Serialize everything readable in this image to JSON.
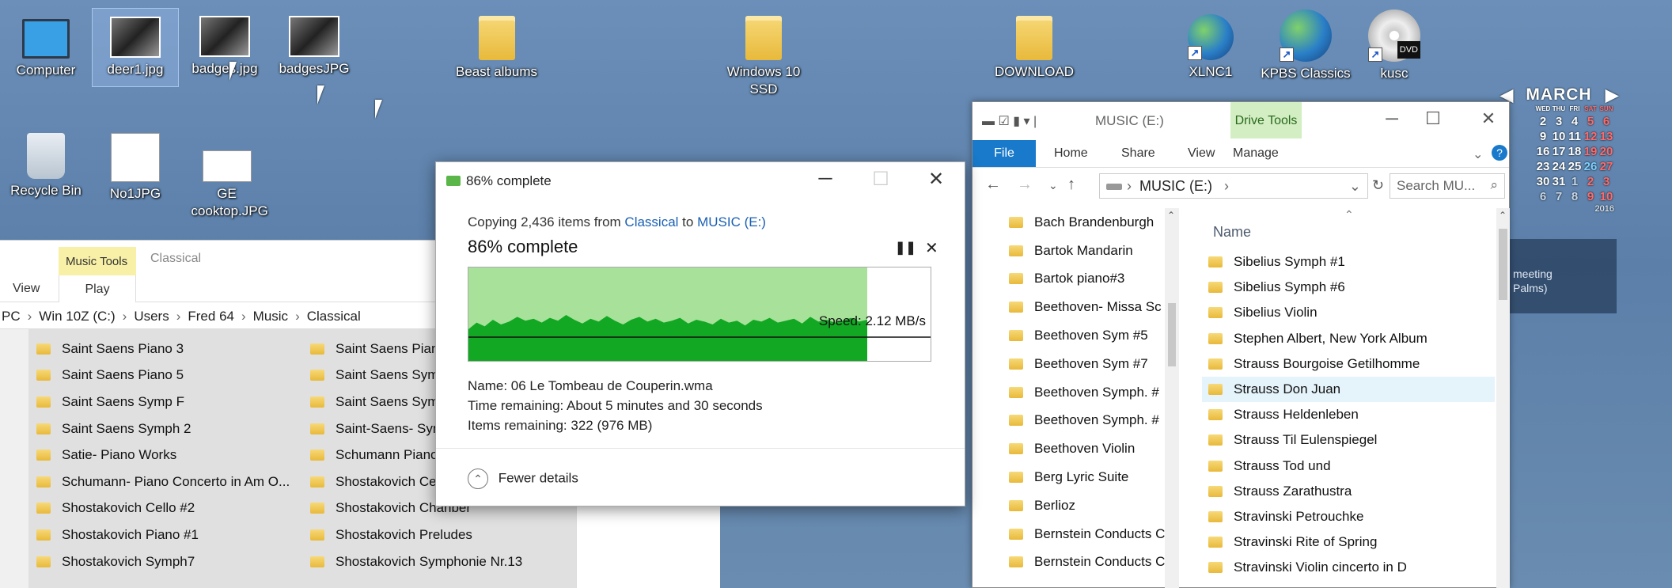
{
  "desktop": {
    "icons": [
      {
        "label": "Computer"
      },
      {
        "label": "deer1.jpg"
      },
      {
        "label": "badges.jpg"
      },
      {
        "label": "badgesJPG"
      },
      {
        "label": "Beast albums"
      },
      {
        "label": "Windows 10 SSD"
      },
      {
        "label": "DOWNLOAD"
      },
      {
        "label": "XLNC1"
      },
      {
        "label": "KPBS Classics"
      },
      {
        "label": "kusc"
      },
      {
        "label": "Recycle Bin"
      },
      {
        "label": "No1JPG"
      },
      {
        "label": "GE cooktop.JPG"
      }
    ],
    "dvd_label": "DVD"
  },
  "calendar": {
    "month": "MARCH",
    "weekdays": [
      "WED",
      "THU",
      "FRI",
      "SAT",
      "SUN"
    ],
    "rows": [
      [
        "2",
        "3",
        "4",
        "5",
        "6"
      ],
      [
        "9",
        "10",
        "11",
        "12",
        "13"
      ],
      [
        "16",
        "17",
        "18",
        "19",
        "20"
      ],
      [
        "23",
        "24",
        "25",
        "26",
        "27"
      ],
      [
        "30",
        "31",
        "1",
        "2",
        "3"
      ],
      [
        "6",
        "7",
        "8",
        "9",
        "10"
      ]
    ],
    "year": "2016"
  },
  "gadget": {
    "line1": "meeting",
    "line2": "Palms)"
  },
  "left_explorer": {
    "ribbon": {
      "context_tab": "Music Tools",
      "context_name": "Classical",
      "tab_view": "View",
      "tab_play": "Play"
    },
    "breadcrumb": [
      "PC",
      "Win 10Z (C:)",
      "Users",
      "Fred 64",
      "Music",
      "Classical"
    ],
    "col1": [
      "Saint Saens Piano 3",
      "Saint Saens Piano 5",
      "Saint Saens Symp F",
      "Saint Saens Symph 2",
      "Satie- Piano Works",
      "Schumann- Piano Concerto in Am O...",
      "Shostakovich Cello #2",
      "Shostakovich Piano #1",
      "Shostakovich Symph7"
    ],
    "col2": [
      "Saint Saens Pianc",
      "Saint Saens Symp",
      "Saint Saens Symp",
      "Saint-Saens- Sym",
      "Schumann Piano",
      "Shostakovich Cel",
      "Shostakovich Chanber",
      "Shostakovich Preludes",
      "Shostakovich Symphonie Nr.13"
    ]
  },
  "right_explorer": {
    "title": "MUSIC (E:)",
    "drive_tools": "Drive Tools",
    "tabs": {
      "file": "File",
      "home": "Home",
      "share": "Share",
      "view": "View",
      "manage": "Manage"
    },
    "address": "MUSIC (E:)",
    "search_placeholder": "Search MU...",
    "column_name": "Name",
    "nav_items": [
      "Bach Brandenburgh",
      "Bartok Mandarin",
      "Bartok piano#3",
      "Beethoven- Missa Sc",
      "Beethoven Sym #5",
      "Beethoven Sym #7",
      "Beethoven Symph. #",
      "Beethoven Symph. #",
      "Beethoven Violin",
      "Berg Lyric Suite",
      "Berlioz",
      "Bernstein Conducts C",
      "Bernstein Conducts C"
    ],
    "files": [
      "Sibelius Symph #1",
      "Sibelius Symph #6",
      "Sibelius Violin",
      "Stephen Albert, New York Album",
      "Strauss Bourgoise Getilhomme",
      "Strauss Don Juan",
      "Strauss Heldenleben",
      "Strauss Til Eulenspiegel",
      "Strauss Tod und",
      "Strauss Zarathustra",
      "Stravinski Petrouchke",
      "Stravinski Rite of Spring",
      "Stravinski Violin cincerto in D"
    ]
  },
  "copy_dialog": {
    "title": "86% complete",
    "copy_prefix": "Copying 2,436 items from ",
    "source": "Classical",
    "copy_mid": " to ",
    "dest": "MUSIC (E:)",
    "percent_text": "86% complete",
    "progress_fraction": 0.86,
    "speed": "Speed: 2.12 MB/s",
    "name_line": "Name: 06 Le Tombeau de Couperin.wma",
    "time_line": "Time remaining: About 5 minutes and 30 seconds",
    "items_line": "Items remaining: 322 (976 MB)",
    "fewer_details": "Fewer details",
    "speed_samples": [
      0.35,
      0.42,
      0.38,
      0.45,
      0.4,
      0.43,
      0.48,
      0.44,
      0.46,
      0.42,
      0.47,
      0.44,
      0.5,
      0.45,
      0.41,
      0.46,
      0.43,
      0.49,
      0.44,
      0.4,
      0.45,
      0.48,
      0.43,
      0.46,
      0.42,
      0.44,
      0.47,
      0.41,
      0.45,
      0.43,
      0.4,
      0.46,
      0.42,
      0.44,
      0.39,
      0.45,
      0.43,
      0.47,
      0.42,
      0.44,
      0.46,
      0.41,
      0.48,
      0.43,
      0.45,
      0.42,
      0.44,
      0.47,
      0.43,
      0.45
    ]
  }
}
